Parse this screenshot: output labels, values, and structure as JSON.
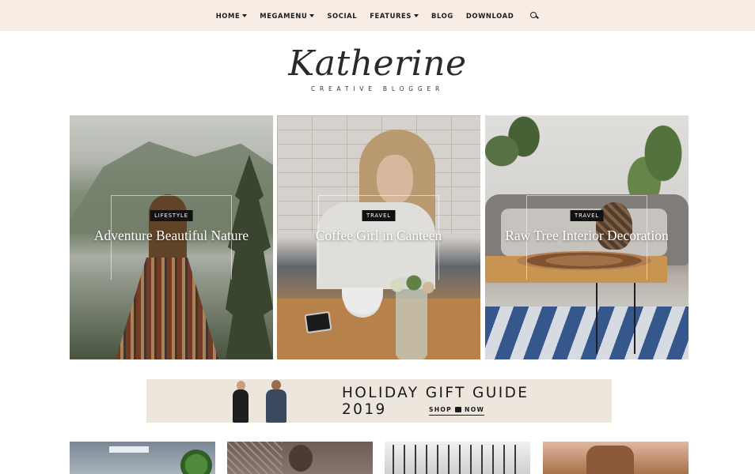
{
  "nav": {
    "items": [
      {
        "label": "HOME",
        "has_dropdown": true
      },
      {
        "label": "MEGAMENU",
        "has_dropdown": true
      },
      {
        "label": "SOCIAL",
        "has_dropdown": false
      },
      {
        "label": "FEATURES",
        "has_dropdown": true
      },
      {
        "label": "BLOG",
        "has_dropdown": false
      },
      {
        "label": "DOWNLOAD",
        "has_dropdown": false
      }
    ],
    "search_icon": "search-icon",
    "background_color": "#f7ede4"
  },
  "logo": {
    "name": "Katherine",
    "tagline": "CREATIVE BLOGGER"
  },
  "featured": [
    {
      "category": "LIFESTYLE",
      "title": "Adventure Beautiful Nature"
    },
    {
      "category": "TRAVEL",
      "title": "Coffee Girl in Canteen"
    },
    {
      "category": "TRAVEL",
      "title": "Raw Tree Interior Decoration"
    }
  ],
  "banner": {
    "title": "HOLIDAY GIFT GUIDE 2019",
    "cta_left": "SHOP",
    "cta_right": "NOW",
    "background_color": "#ece6dd"
  },
  "colors": {
    "badge": "#111111",
    "text": "#1d1d1d"
  }
}
